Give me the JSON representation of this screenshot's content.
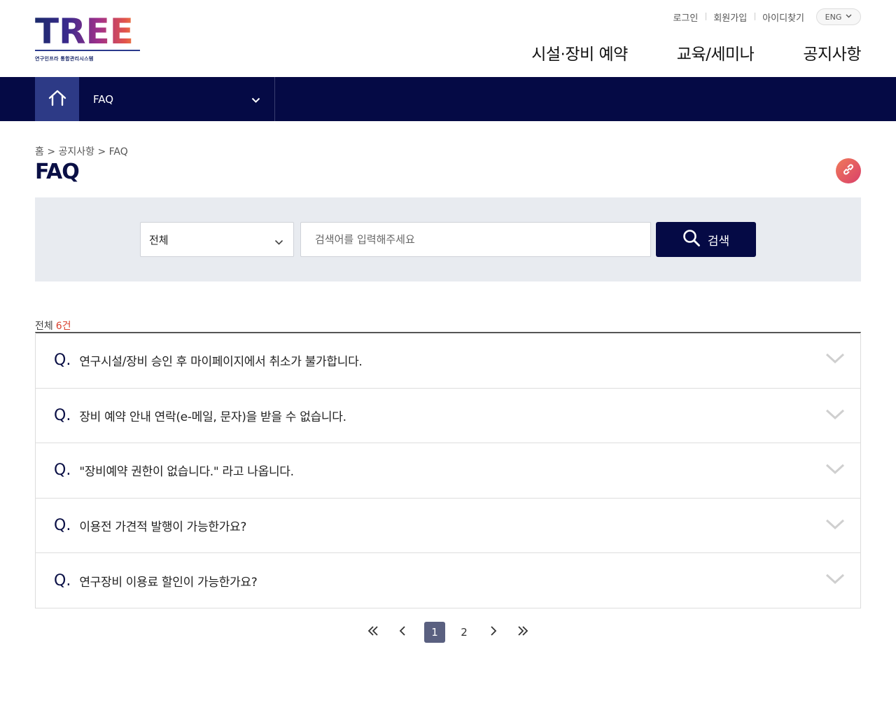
{
  "header": {
    "logo_text": "TREE",
    "logo_subtitle": "연구인프라 통합관리시스템",
    "util_links": [
      "로그인",
      "회원가입",
      "아이디찾기"
    ],
    "lang": "ENG",
    "gnb": [
      "시설·장비 예약",
      "교육/세미나",
      "공지사항"
    ]
  },
  "navbar": {
    "current": "FAQ"
  },
  "page": {
    "breadcrumb": "홈 > 공지사항 > FAQ",
    "title": "FAQ"
  },
  "search": {
    "category": "전체",
    "placeholder": "검색어를 입력해주세요",
    "button": "검색"
  },
  "list": {
    "total_label": "전체",
    "total_count": "6건",
    "q_prefix": "Q.",
    "items": [
      "연구시설/장비 승인 후 마이페이지에서 취소가 불가합니다.",
      "장비 예약 안내 연락(e-메일, 문자)을 받을 수 없습니다.",
      "\"장비예약 권한이 없습니다.\" 라고 나옵니다.",
      "이용전 가견적 발행이 가능한가요?",
      "연구장비 이용료 할인이 가능한가요?"
    ]
  },
  "pagination": {
    "pages": [
      "1",
      "2"
    ],
    "current": "1"
  },
  "colors": {
    "navy": "#050a45",
    "accent_red": "#d9412f"
  }
}
